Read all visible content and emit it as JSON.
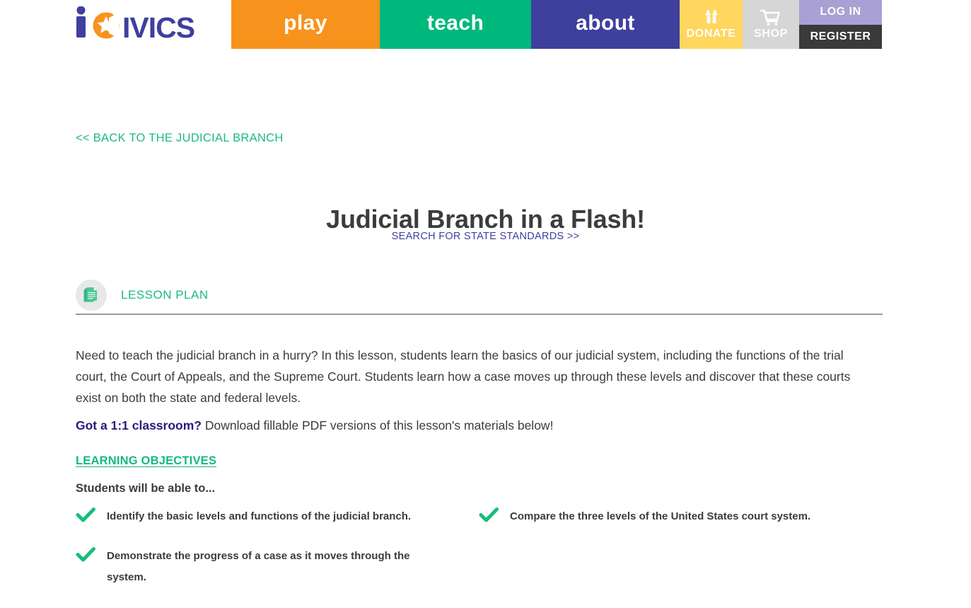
{
  "header": {
    "logo": {
      "name": "iCivics",
      "text_before": "i",
      "text_after": "IVICS",
      "purple": "#3f3f9e",
      "orange": "#f7931d"
    },
    "nav": [
      {
        "label": "play",
        "color": "#f7931d",
        "icon": ""
      },
      {
        "label": "teach",
        "color": "#00b87c",
        "icon": ""
      },
      {
        "label": "about",
        "color": "#3f3f9e",
        "icon": ""
      }
    ],
    "utility": [
      {
        "label": "DONATE",
        "icon": "gift-icon",
        "color": "#ffd65e"
      },
      {
        "label": "SHOP",
        "icon": "cart-icon",
        "color": "#d6d6d6"
      }
    ],
    "auth": {
      "login_label": "LOG IN",
      "login_color": "#a9a0d4",
      "register_label": "REGISTER",
      "register_color": "#3a3a3a"
    }
  },
  "page": {
    "back_link": "<< BACK TO THE JUDICIAL BRANCH",
    "title": "Judicial Branch in a Flash!",
    "standards_link": "SEARCH FOR STATE STANDARDS >>",
    "resource_type": "LESSON PLAN",
    "resource_type_icon": "documents-icon",
    "accent_green": "#1eb980",
    "accent_purple": "#3f3f9e",
    "description": "Need to teach the judicial branch in a hurry? In this lesson, students learn the basics of our judicial system, including the functions of the trial court, the Court of Appeals, and the Supreme Court. Students learn how a case moves up through these levels and discover that these courts exist on both the state and federal levels.",
    "one_to_one": {
      "bold": "Got a 1:1 classroom?",
      "rest": " Download fillable PDF versions of this lesson's materials below!"
    },
    "objectives": {
      "heading": "LEARNING OBJECTIVES",
      "subheading": "Students will be able to...",
      "items": [
        "Identify the basic levels and functions of the judicial branch.",
        "Compare the three levels of the United States court system.",
        "Demonstrate the progress of a case as it moves through the system."
      ]
    }
  }
}
